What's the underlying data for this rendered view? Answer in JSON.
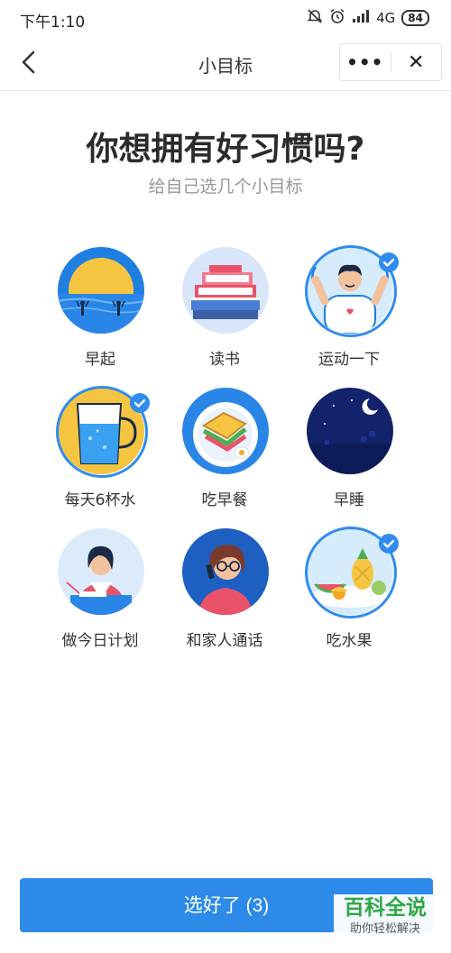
{
  "status_bar": {
    "time": "下午1:10",
    "network": "4G",
    "battery": "84"
  },
  "navbar": {
    "title": "小目标",
    "more_label": "•••",
    "close_label": "✕"
  },
  "heading": "你想拥有好习惯吗?",
  "subheading": "给自己选几个小目标",
  "habits": [
    {
      "label": "早起",
      "selected": false,
      "icon": "sunrise-icon"
    },
    {
      "label": "读书",
      "selected": false,
      "icon": "books-icon"
    },
    {
      "label": "运动一下",
      "selected": true,
      "icon": "exercise-icon"
    },
    {
      "label": "每天6杯水",
      "selected": true,
      "icon": "water-cup-icon"
    },
    {
      "label": "吃早餐",
      "selected": false,
      "icon": "breakfast-icon"
    },
    {
      "label": "早睡",
      "selected": false,
      "icon": "night-moon-icon"
    },
    {
      "label": "做今日计划",
      "selected": false,
      "icon": "planning-icon"
    },
    {
      "label": "和家人通话",
      "selected": false,
      "icon": "phone-call-icon"
    },
    {
      "label": "吃水果",
      "selected": true,
      "icon": "fruit-icon"
    }
  ],
  "confirm_button": "选好了 (3)",
  "watermark": {
    "title": "百科全说",
    "subtitle": "助你轻松解决"
  },
  "colors": {
    "accent": "#2d8ae8",
    "watermark": "#2eaa3e"
  }
}
